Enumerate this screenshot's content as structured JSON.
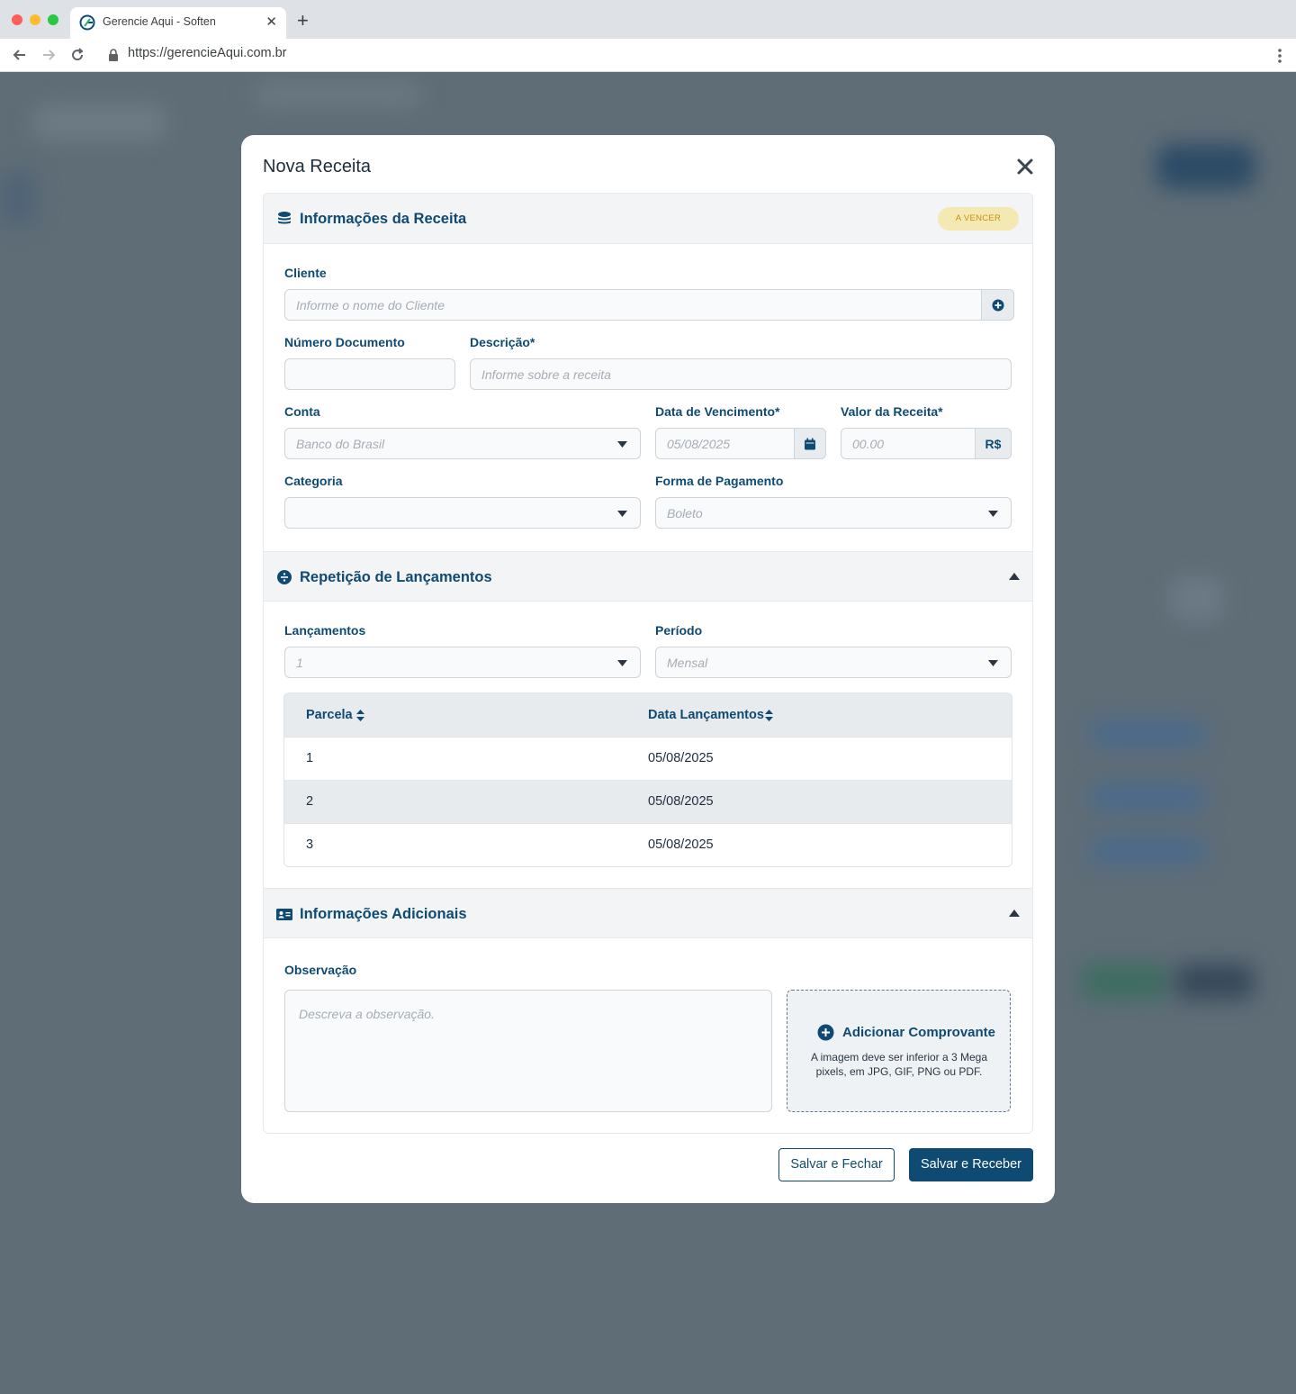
{
  "browser": {
    "tab_title": "Gerencie Aqui - Soften",
    "url": "https://gerencieAqui.com.br"
  },
  "modal": {
    "title": "Nova Receita",
    "sections": {
      "info": {
        "title": "Informações da Receita",
        "status_badge": "A VENCER"
      },
      "repeat": {
        "title": "Repetição de Lançamentos"
      },
      "extra": {
        "title": "Informações Adicionais"
      }
    },
    "fields": {
      "cliente": {
        "label": "Cliente",
        "placeholder": "Informe o nome do Cliente"
      },
      "numero_documento": {
        "label": "Número Documento",
        "value": ""
      },
      "descricao": {
        "label": "Descrição*",
        "placeholder": "Informe sobre a receita"
      },
      "conta": {
        "label": "Conta",
        "value": "Banco do Brasil"
      },
      "data_vencimento": {
        "label": "Data de Vencimento*",
        "value": "05/08/2025"
      },
      "valor": {
        "label": "Valor da Receita*",
        "placeholder": "00.00",
        "currency": "R$"
      },
      "categoria": {
        "label": "Categoria",
        "value": ""
      },
      "forma_pagamento": {
        "label": "Forma de Pagamento",
        "value": "Boleto"
      },
      "lancamentos": {
        "label": "Lançamentos",
        "value": "1"
      },
      "periodo": {
        "label": "Período",
        "value": "Mensal"
      },
      "observacao": {
        "label": "Observação",
        "placeholder": "Descreva a observação."
      }
    },
    "table": {
      "columns": [
        "Parcela",
        "Data Lançamentos"
      ],
      "rows": [
        {
          "parcela": "1",
          "data": "05/08/2025"
        },
        {
          "parcela": "2",
          "data": "05/08/2025"
        },
        {
          "parcela": "3",
          "data": "05/08/2025"
        }
      ]
    },
    "upload": {
      "title": "Adicionar Comprovante",
      "hint": "A imagem deve ser inferior a 3 Mega pixels, em JPG, GIF, PNG ou PDF."
    },
    "buttons": {
      "save_close": "Salvar e Fechar",
      "save_receive": "Salvar e Receber"
    }
  },
  "colors": {
    "primary": "#0f4a72",
    "badge_bg": "#f4e9b3",
    "badge_text": "#c98f0e",
    "overlay": "#5f6d77"
  }
}
